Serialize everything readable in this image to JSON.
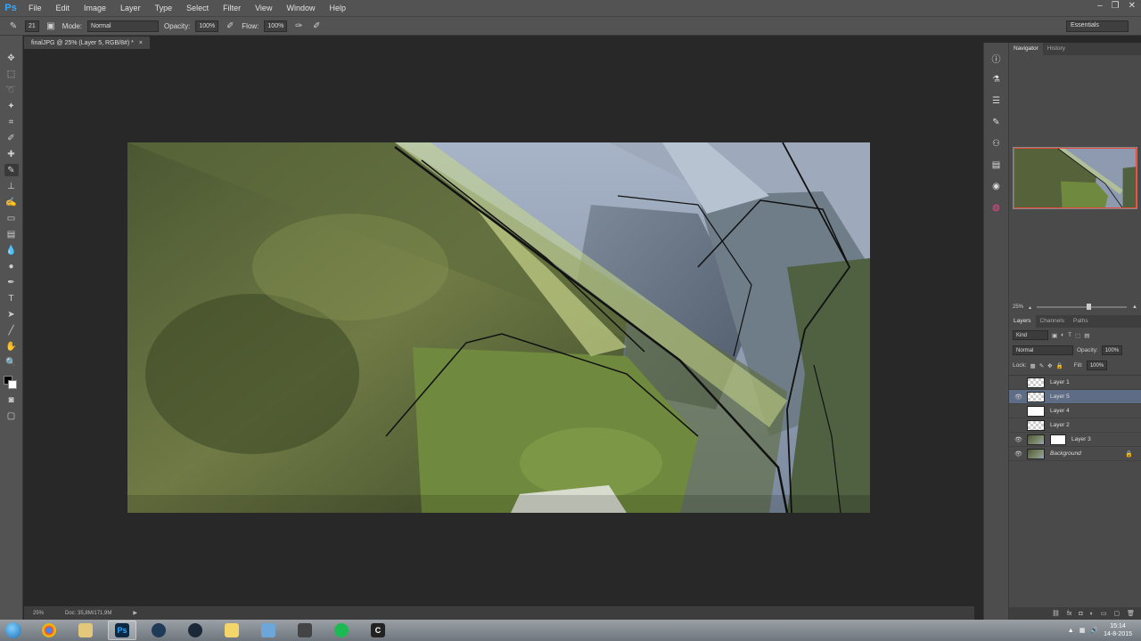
{
  "app": {
    "logo": "Ps"
  },
  "menu": [
    "File",
    "Edit",
    "Image",
    "Layer",
    "Type",
    "Select",
    "Filter",
    "View",
    "Window",
    "Help"
  ],
  "options_bar": {
    "brush_size": "21",
    "mode_label": "Mode:",
    "mode_value": "Normal",
    "opacity_label": "Opacity:",
    "opacity_value": "100%",
    "flow_label": "Flow:",
    "flow_value": "100%",
    "workspace": "Essentials"
  },
  "document": {
    "tab_title": "finalJPG @ 25% (Layer 5, RGB/8#) *",
    "close_glyph": "×"
  },
  "status": {
    "zoom": "25%",
    "doc_size": "Doc: 35,8M/171,9M"
  },
  "navigator": {
    "tabs": [
      "Navigator",
      "History"
    ],
    "zoom": "25%"
  },
  "layers_panel": {
    "tabs": [
      "Layers",
      "Channels",
      "Paths"
    ],
    "kind_label": "Kind",
    "blend_mode": "Normal",
    "opacity_label": "Opacity:",
    "opacity_value": "100%",
    "lock_label": "Lock:",
    "fill_label": "Fill:",
    "fill_value": "100%",
    "layers": [
      {
        "name": "Layer 1",
        "thumb": "transparent",
        "visible": false,
        "selected": false
      },
      {
        "name": "Layer 5",
        "thumb": "transparent",
        "visible": true,
        "selected": true
      },
      {
        "name": "Layer 4",
        "thumb": "white",
        "visible": false,
        "selected": false
      },
      {
        "name": "Layer 2",
        "thumb": "transparent",
        "visible": false,
        "selected": false
      },
      {
        "name": "Layer 3",
        "thumb": "photo",
        "visible": true,
        "selected": false
      },
      {
        "name": "Background",
        "thumb": "photo",
        "visible": true,
        "selected": false
      }
    ]
  },
  "taskbar": {
    "apps": [
      {
        "name": "chrome",
        "label": ""
      },
      {
        "name": "explorer",
        "label": ""
      },
      {
        "name": "photoshop",
        "label": "Ps"
      },
      {
        "name": "wacom",
        "label": ""
      },
      {
        "name": "steam",
        "label": ""
      },
      {
        "name": "folder",
        "label": ""
      },
      {
        "name": "paint",
        "label": ""
      },
      {
        "name": "zbrush",
        "label": ""
      },
      {
        "name": "spotify",
        "label": ""
      },
      {
        "name": "cinema4d",
        "label": "C"
      }
    ],
    "time": "15:14",
    "date": "14-8-2015"
  },
  "colors": {
    "foreground": "#000000",
    "background": "#ffffff",
    "selected_layer": "#5e6c86",
    "nav_view_rect": "#e74a3b"
  }
}
